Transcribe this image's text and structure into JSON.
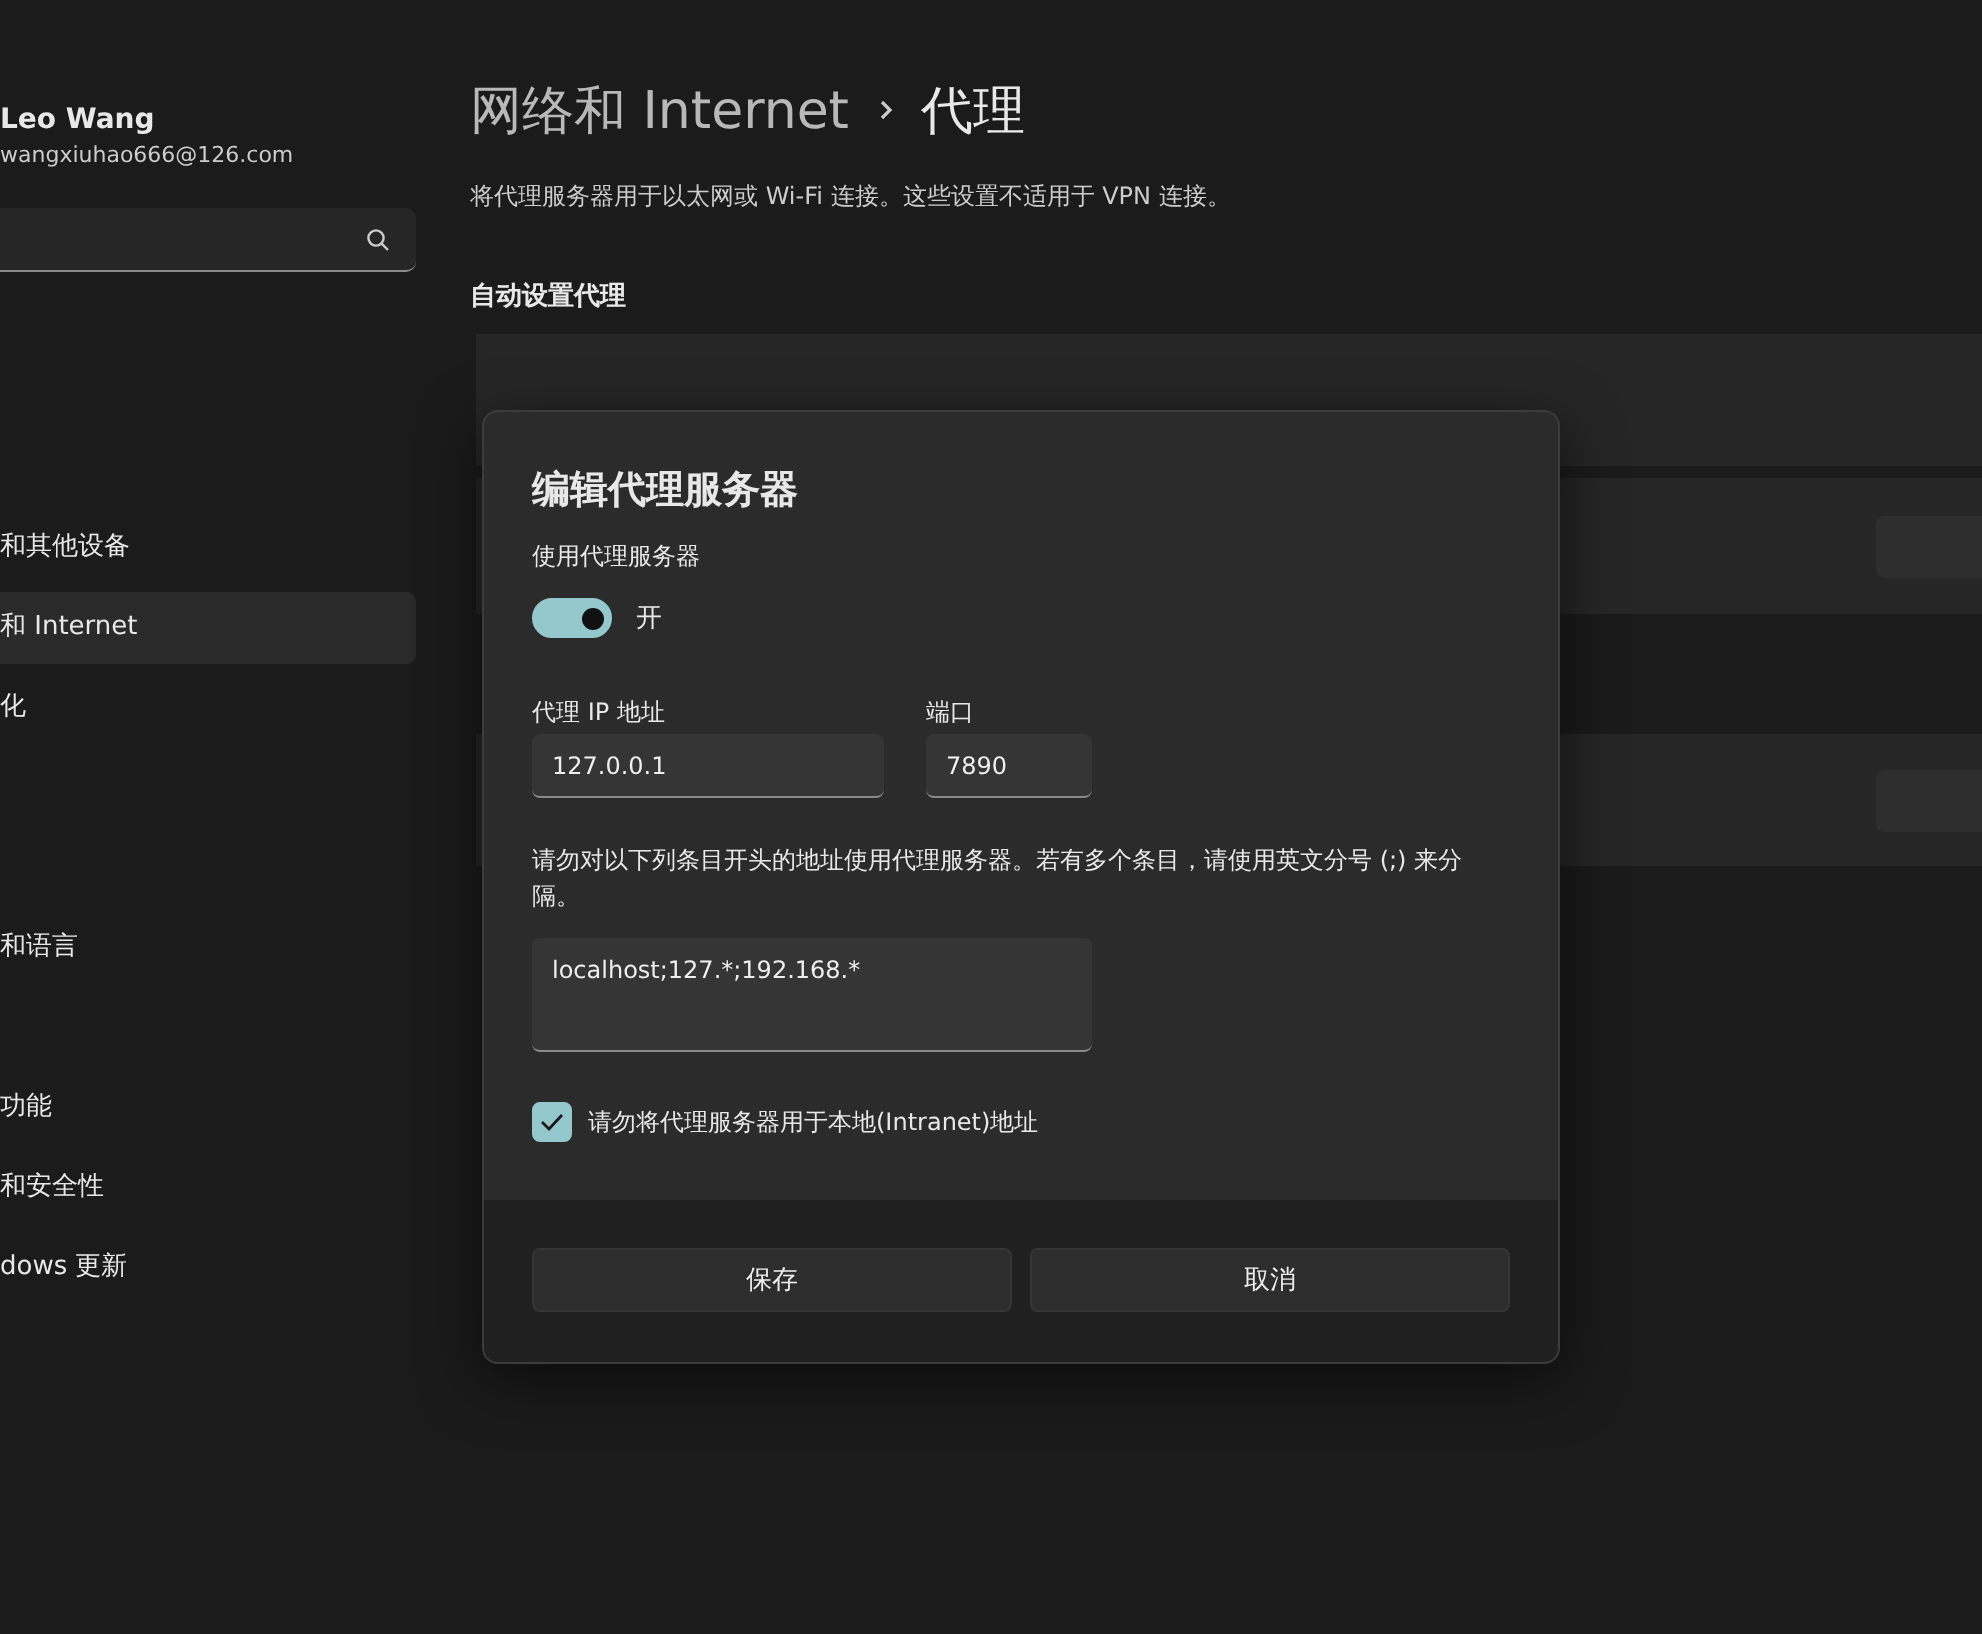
{
  "sidebar": {
    "user": {
      "name": "Leo Wang",
      "email": "wangxiuhao666@126.com"
    },
    "items": [
      {
        "label": "和其他设备",
        "selected": false
      },
      {
        "label": "和 Internet",
        "selected": true
      },
      {
        "label": "化",
        "selected": false
      },
      {
        "label": "和语言",
        "selected": false
      },
      {
        "label": "功能",
        "selected": false
      },
      {
        "label": "和安全性",
        "selected": false
      },
      {
        "label": "dows 更新",
        "selected": false
      }
    ]
  },
  "page": {
    "breadcrumb": [
      "网络和 Internet",
      "代理"
    ],
    "description": "将代理服务器用于以太网或 Wi-Fi 连接。这些设置不适用于 VPN 连接。",
    "section": "自动设置代理"
  },
  "dialog": {
    "title": "编辑代理服务器",
    "toggle_label": "使用代理服务器",
    "toggle": {
      "on": true,
      "text": "开"
    },
    "ip": {
      "label": "代理 IP 地址",
      "value": "127.0.0.1"
    },
    "port": {
      "label": "端口",
      "value": "7890"
    },
    "exceptions_help": "请勿对以下列条目开头的地址使用代理服务器。若有多个条目，请使用英文分号 (;) 来分隔。",
    "exceptions": "localhost;127.*;192.168.*",
    "local": {
      "checked": true,
      "label": "请勿将代理服务器用于本地(Intranet)地址"
    },
    "buttons": [
      "保存",
      "取消"
    ]
  }
}
